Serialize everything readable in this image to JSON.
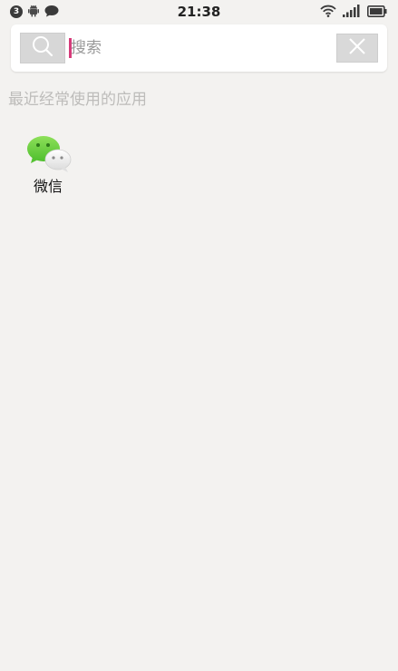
{
  "status_bar": {
    "notification_count": "3",
    "time": "21:38",
    "icons": [
      "android-icon",
      "message-bubble-icon",
      "wifi-icon",
      "signal-icon",
      "battery-icon"
    ]
  },
  "search": {
    "placeholder": "搜索",
    "value": "",
    "accent_color": "#d63b7a"
  },
  "recent_section": {
    "title": "最近经常使用的应用",
    "apps": [
      {
        "label": "微信",
        "icon": "wechat-icon"
      }
    ]
  },
  "colors": {
    "background": "#f3f2f0",
    "wechat_green": "#5fcb3a"
  }
}
